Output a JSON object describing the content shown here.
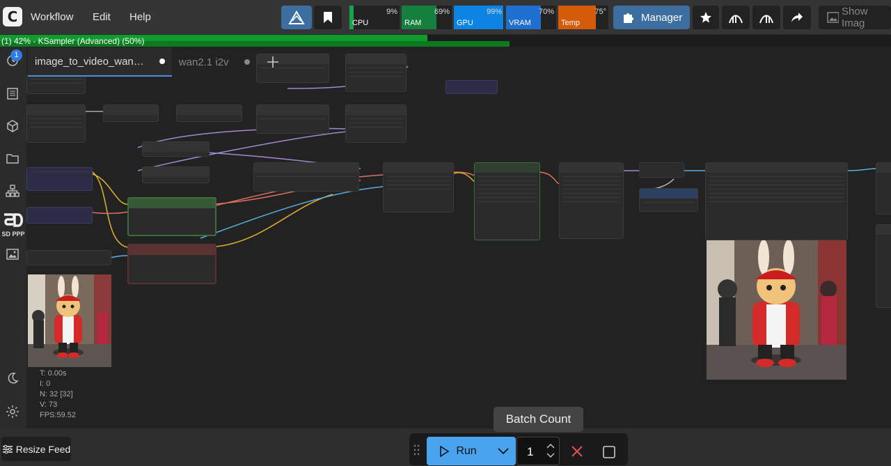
{
  "app": {
    "logo_letter": "C"
  },
  "menu": {
    "workflow": "Workflow",
    "edit": "Edit",
    "help": "Help"
  },
  "monitors": [
    {
      "label": "CPU",
      "pct": "9%",
      "fraction": 0.09,
      "color": "#16a34a"
    },
    {
      "label": "RAM",
      "pct": "69%",
      "fraction": 0.69,
      "color": "#15803d"
    },
    {
      "label": "GPU",
      "pct": "99%",
      "fraction": 0.99,
      "color": "#0b84e3"
    },
    {
      "label": "VRAM",
      "pct": "70%",
      "fraction": 0.7,
      "color": "#1f6fd1"
    },
    {
      "label": "Temp",
      "pct": "75°",
      "fraction": 0.75,
      "color": "#d35b0a"
    }
  ],
  "toolbar": {
    "manager_label": "Manager",
    "show_image_label": "Show Imag"
  },
  "progress": {
    "text": "(1) 42% - KSampler (Advanced) (50%)",
    "overall": 0.48,
    "node": 0.572
  },
  "tabs": [
    {
      "label": "image_to_video_wan…",
      "modified": true
    },
    {
      "label": "wan2.1 i2v",
      "modified": true
    }
  ],
  "sidebar": {
    "queue_badge": "1",
    "sd_label": "SD PPP"
  },
  "stats": {
    "t": "T: 0.00s",
    "i": "I: 0",
    "n": "N: 32 [32]",
    "v": "V: 73",
    "fps": "FPS:59.52"
  },
  "bottom": {
    "resize_feed": "Resize Feed",
    "tooltip": "Batch Count",
    "run_label": "Run",
    "batch_count": "1"
  },
  "colors": {
    "accent": "#4aa3ee",
    "cancel": "#e05353"
  }
}
